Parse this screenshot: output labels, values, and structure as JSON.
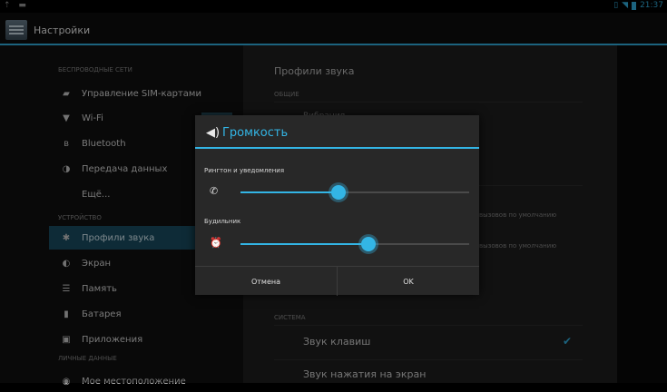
{
  "status_bar": {
    "time": "21:37"
  },
  "action_bar": {
    "title": "Настройки"
  },
  "left_menu": {
    "sections": {
      "wireless": "БЕСПРОВОДНЫЕ СЕТИ",
      "device": "УСТРОЙСТВО",
      "personal": "ЛИЧНЫЕ ДАННЫЕ"
    },
    "items": [
      {
        "label": "Управление SIM-картами",
        "icon": "sim-icon"
      },
      {
        "label": "Wi-Fi",
        "icon": "wifi-icon"
      },
      {
        "label": "Bluetooth",
        "icon": "bluetooth-icon"
      },
      {
        "label": "Передача данных",
        "icon": "data-usage-icon"
      },
      {
        "label": "Ещё...",
        "icon": ""
      },
      {
        "label": "Профили звука",
        "icon": "sound-icon",
        "selected": true
      },
      {
        "label": "Экран",
        "icon": "display-icon"
      },
      {
        "label": "Память",
        "icon": "storage-icon"
      },
      {
        "label": "Батарея",
        "icon": "battery-icon"
      },
      {
        "label": "Приложения",
        "icon": "apps-icon"
      },
      {
        "label": "Мое местоположение",
        "icon": "location-icon"
      }
    ]
  },
  "right_pane": {
    "title": "Профили звука",
    "section_general": "ОБЩИЕ",
    "partial_text_1": "Вибрация",
    "partial_text_2": "вызовов по умолчанию",
    "partial_text_3": "вызовов по умолчанию",
    "section_system": "СИСТЕМА",
    "key_sound": "Звук клавиш",
    "touch_sound": "Звук нажатия на экран"
  },
  "dialog": {
    "title": "Громкость",
    "ringtone_label": "Рингтон и уведомления",
    "ringtone_level": 0.43,
    "alarm_label": "Будильник",
    "alarm_level": 0.56,
    "cancel": "Отмена",
    "ok": "OK"
  },
  "colors": {
    "accent": "#33b5e5",
    "selected_bg": "#1a4f64"
  }
}
